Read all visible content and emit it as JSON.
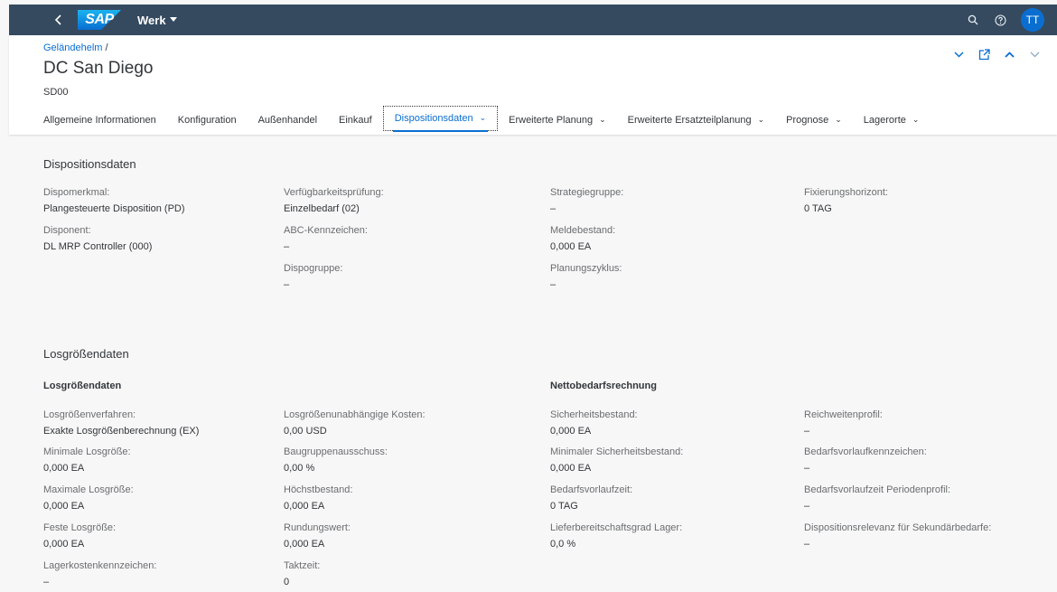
{
  "shell": {
    "back_icon": "chevron-left-icon",
    "logo": "SAP",
    "title": "Werk",
    "title_dropdown_icon": "triangle-down-icon",
    "search_icon": "search-icon",
    "help_icon": "help-icon",
    "avatar_initials": "TT",
    "brand_color": "#354a5f",
    "accent_color": "#0a6ed1"
  },
  "header": {
    "breadcrumb_link": "Geländehelm",
    "breadcrumb_sep": "/",
    "title": "DC San Diego",
    "subtitle": "SD00",
    "action_icons": [
      "chevron-down-icon",
      "open-in-new-icon",
      "chevron-up-icon",
      "chevron-down-icon"
    ]
  },
  "tabs": [
    {
      "label": "Allgemeine Informationen"
    },
    {
      "label": "Konfiguration"
    },
    {
      "label": "Außenhandel"
    },
    {
      "label": "Einkauf"
    },
    {
      "label": "Dispositionsdaten",
      "active": true,
      "dropdown": true
    },
    {
      "label": "Erweiterte Planung",
      "dropdown": true
    },
    {
      "label": "Erweiterte Ersatzteilplanung",
      "dropdown": true
    },
    {
      "label": "Prognose",
      "dropdown": true
    },
    {
      "label": "Lagerorte",
      "dropdown": true
    }
  ],
  "dispo": {
    "title": "Dispositionsdaten",
    "fields": {
      "dispomerkmal": {
        "label": "Dispomerkmal:",
        "value": "Plangesteuerte Disposition (PD)"
      },
      "disponent": {
        "label": "Disponent:",
        "value": "DL MRP Controller (000)"
      },
      "verfuegbarkeit": {
        "label": "Verfügbarkeitsprüfung:",
        "value": "Einzelbedarf (02)"
      },
      "abc": {
        "label": "ABC-Kennzeichen:",
        "value": "–"
      },
      "dispogruppe": {
        "label": "Dispogruppe:",
        "value": "–"
      },
      "strategiegruppe": {
        "label": "Strategiegruppe:",
        "value": "–"
      },
      "meldebestand": {
        "label": "Meldebestand:",
        "value": "0,000 EA"
      },
      "planungszyklus": {
        "label": "Planungszyklus:",
        "value": "–"
      },
      "fixierungshorizont": {
        "label": "Fixierungshorizont:",
        "value": "0 TAG"
      }
    }
  },
  "los": {
    "title": "Losgrößendaten",
    "sub_left": "Losgrößendaten",
    "sub_right": "Nettobedarfsrechnung",
    "fields": {
      "verfahren": {
        "label": "Losgrößenverfahren:",
        "value": "Exakte Losgrößenberechnung (EX)"
      },
      "min": {
        "label": "Minimale Losgröße:",
        "value": "0,000 EA"
      },
      "max": {
        "label": "Maximale Losgröße:",
        "value": "0,000 EA"
      },
      "fest": {
        "label": "Feste Losgröße:",
        "value": "0,000 EA"
      },
      "lagerkosten": {
        "label": "Lagerkostenkennzeichen:",
        "value": "–"
      },
      "kosten": {
        "label": "Losgrößenunabhängige Kosten:",
        "value": "0,00  USD"
      },
      "ausschuss": {
        "label": "Baugruppenausschuss:",
        "value": "0,00 %"
      },
      "hoechst": {
        "label": "Höchstbestand:",
        "value": "0,000 EA"
      },
      "rundung": {
        "label": "Rundungswert:",
        "value": "0,000 EA"
      },
      "taktzeit": {
        "label": "Taktzeit:",
        "value": "0"
      },
      "sicherheit": {
        "label": "Sicherheitsbestand:",
        "value": "0,000 EA"
      },
      "minsicherheit": {
        "label": "Minimaler Sicherheitsbestand:",
        "value": "0,000 EA"
      },
      "bedarfsvorlauf": {
        "label": "Bedarfsvorlaufzeit:",
        "value": "0 TAG"
      },
      "lieferbereitschaft": {
        "label": "Lieferbereitschaftsgrad Lager:",
        "value": "0,0 %"
      },
      "reichweite": {
        "label": "Reichweitenprofil:",
        "value": "–"
      },
      "bedarfskz": {
        "label": "Bedarfsvorlaufkennzeichen:",
        "value": "–"
      },
      "periodenprofil": {
        "label": "Bedarfsvorlaufzeit Periodenprofil:",
        "value": "–"
      },
      "sekundaer": {
        "label": "Dispositionsrelevanz für Sekundärbedarfe:",
        "value": "–"
      }
    }
  }
}
